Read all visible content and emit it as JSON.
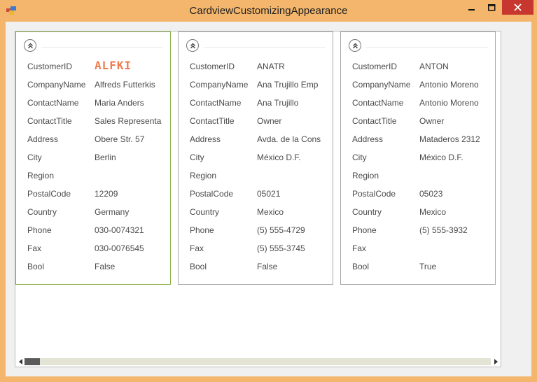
{
  "window": {
    "title": "CardviewCustomizingAppearance",
    "controls": {
      "minimize": "–",
      "maximize": "□",
      "close": "✕"
    }
  },
  "fields": [
    "CustomerID",
    "CompanyName",
    "ContactName",
    "ContactTitle",
    "Address",
    "City",
    "Region",
    "PostalCode",
    "Country",
    "Phone",
    "Fax",
    "Bool"
  ],
  "cards": [
    {
      "focused": true,
      "values": [
        "ALFKI",
        "Alfreds Futterkis",
        "Maria Anders",
        "Sales Representa",
        "Obere Str. 57",
        "Berlin",
        "",
        "12209",
        "Germany",
        "030-0074321",
        "030-0076545",
        "False"
      ]
    },
    {
      "focused": false,
      "values": [
        "ANATR",
        "Ana Trujillo Emp",
        "Ana Trujillo",
        "Owner",
        "Avda. de la Cons",
        "México D.F.",
        "",
        "05021",
        "Mexico",
        "(5) 555-4729",
        "(5) 555-3745",
        "False"
      ]
    },
    {
      "focused": false,
      "values": [
        "ANTON",
        "Antonio Moreno",
        "Antonio Moreno",
        "Owner",
        "Mataderos  2312",
        "México D.F.",
        "",
        "05023",
        "Mexico",
        "(5) 555-3932",
        "",
        "True"
      ]
    }
  ],
  "colors": {
    "titlebar": "#f3b66c",
    "close_button": "#c7372f",
    "focused_border": "#8bb04a",
    "highlight_text": "#f07a4d"
  },
  "icons": {
    "app": "app-icon",
    "collapse": "chevron-double-up-icon"
  }
}
